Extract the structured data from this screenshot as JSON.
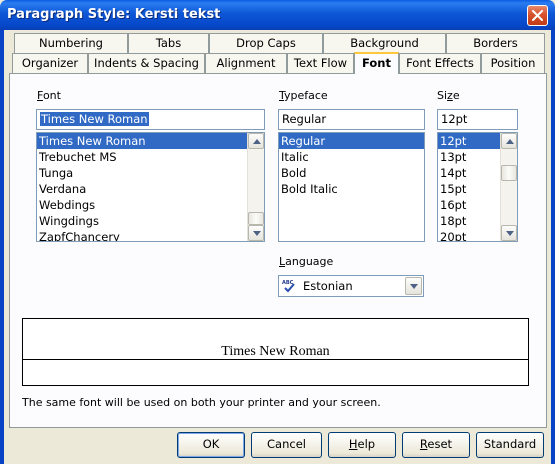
{
  "window": {
    "title": "Paragraph Style: Kersti tekst"
  },
  "tabs_row1": [
    "Numbering",
    "Tabs",
    "Drop Caps",
    "Background",
    "Borders"
  ],
  "tabs_row2": [
    "Organizer",
    "Indents & Spacing",
    "Alignment",
    "Text Flow",
    "Font",
    "Font Effects",
    "Position"
  ],
  "active_tab": "Font",
  "font": {
    "label": "Font",
    "label_accel": "F",
    "label_rest": "ont",
    "value": "Times New Roman",
    "items": [
      "Times New Roman",
      "Trebuchet MS",
      "Tunga",
      "Verdana",
      "Webdings",
      "Wingdings",
      "ZapfChancery"
    ],
    "selected_index": 0
  },
  "typeface": {
    "label_accel": "T",
    "label_rest": "ypeface",
    "value": "Regular",
    "items": [
      "Regular",
      "Italic",
      "Bold",
      "Bold Italic"
    ],
    "selected_index": 0
  },
  "size": {
    "label_accel": "z",
    "label_pre": "Si",
    "label_post": "e",
    "value": "12pt",
    "items": [
      "12pt",
      "13pt",
      "14pt",
      "15pt",
      "16pt",
      "18pt",
      "20pt"
    ],
    "selected_index": 0
  },
  "language": {
    "label_accel": "L",
    "label_rest": "anguage",
    "value": "Estonian",
    "icon": "abc-spellcheck-icon"
  },
  "preview": {
    "text": "Times New Roman",
    "note": "The same font will be used on both your printer and your screen."
  },
  "buttons": {
    "ok": "OK",
    "cancel": "Cancel",
    "help_accel": "H",
    "help_rest": "elp",
    "reset_accel": "R",
    "reset_rest": "eset",
    "standard": "Standard"
  },
  "colors": {
    "titlebar": "#0a5de3",
    "selection": "#316ac5",
    "face": "#ece9d8",
    "active_tab_accent": "#ffc73c"
  }
}
